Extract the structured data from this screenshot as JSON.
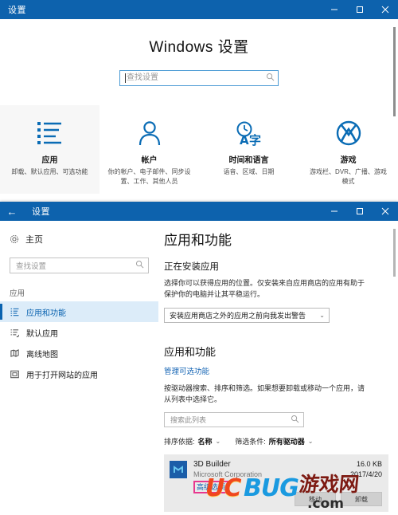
{
  "window_home": {
    "titlebar": {
      "title": "设置",
      "minimize": "–",
      "maximize": "□",
      "close": "✕"
    },
    "heading": "Windows 设置",
    "search": {
      "placeholder": "查找设置",
      "value": "",
      "icon": "search-icon"
    },
    "categories": [
      {
        "icon": "apps-list-icon",
        "title": "应用",
        "desc": "卸载、默认应用、可选功能",
        "highlighted": true
      },
      {
        "icon": "person-icon",
        "title": "帐户",
        "desc": "你的帐户、电子邮件、同步设置、工作、其他人员",
        "highlighted": false
      },
      {
        "icon": "clock-language-icon",
        "title": "时间和语言",
        "desc": "语音、区域、日期",
        "highlighted": false
      },
      {
        "icon": "xbox-icon",
        "title": "游戏",
        "desc": "游戏栏、DVR、广播、游戏模式",
        "highlighted": false
      }
    ]
  },
  "window_apps": {
    "titlebar": {
      "back": "←",
      "title": "设置",
      "minimize": "–",
      "maximize": "□",
      "close": "✕"
    },
    "sidebar": {
      "home": {
        "icon": "gear-icon",
        "label": "主页"
      },
      "search": {
        "placeholder": "查找设置",
        "value": "",
        "icon": "search-icon"
      },
      "group_label": "应用",
      "items": [
        {
          "icon": "apps-features-icon",
          "label": "应用和功能",
          "selected": true
        },
        {
          "icon": "default-apps-icon",
          "label": "默认应用",
          "selected": false
        },
        {
          "icon": "offline-maps-icon",
          "label": "离线地图",
          "selected": false
        },
        {
          "icon": "websites-apps-icon",
          "label": "用于打开网站的应用",
          "selected": false
        }
      ]
    },
    "main": {
      "title": "应用和功能",
      "section_install": {
        "heading": "正在安装应用",
        "paragraph": "选择你可以获得应用的位置。仅安装来自应用商店的应用有助于保护你的电脑并让其平稳运行。",
        "dropdown_value": "安装应用商店之外的应用之前向我发出警告",
        "dropdown_chevron": "⌄"
      },
      "section_features": {
        "heading": "应用和功能",
        "link": "管理可选功能",
        "paragraph": "按驱动器搜索、排序和筛选。如果想要卸载或移动一个应用，请从列表中选择它。",
        "search": {
          "placeholder": "搜索此列表",
          "value": "",
          "icon": "search-icon"
        },
        "sort": {
          "label": "排序依据:",
          "value": "名称",
          "chevron": "⌄"
        },
        "filter": {
          "label": "筛选条件:",
          "value": "所有驱动器",
          "chevron": "⌄"
        }
      },
      "app_list": [
        {
          "icon": "3d-builder-icon",
          "name": "3D Builder",
          "publisher": "Microsoft Corporation",
          "advanced_link": "高级选项",
          "size": "16.0 KB",
          "date": "2017/4/20",
          "actions": [
            "移动",
            "卸载"
          ]
        }
      ]
    }
  },
  "watermark": {
    "part_uc": "UC",
    "part_bug": "BUG",
    "part_cn": "游戏网",
    "part_com": ".com"
  },
  "colors": {
    "titlebar_blue": "#0d62ad",
    "accent_blue": "#0a63b0",
    "link_blue": "#1464b4",
    "highlight_pink": "#e8388f",
    "selected_bg": "#dcecf9",
    "row_bg": "#eaeaea"
  }
}
